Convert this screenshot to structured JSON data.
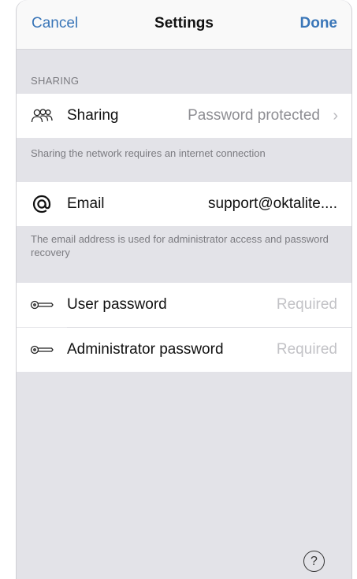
{
  "navbar": {
    "cancel_label": "Cancel",
    "title": "Settings",
    "done_label": "Done",
    "accent_color": "#3a76b8"
  },
  "sharing_section": {
    "header": "SHARING",
    "row": {
      "icon": "people-icon",
      "label": "Sharing",
      "value": "Password protected",
      "chevron": "›"
    },
    "footer": "Sharing the network requires an internet connection"
  },
  "email_section": {
    "row": {
      "icon": "at-sign-icon",
      "label": "Email",
      "value": "support@oktalite...."
    },
    "footer": "The email address is used for administrator access and password recovery"
  },
  "password_section": {
    "rows": [
      {
        "icon": "key-icon",
        "label": "User password",
        "placeholder": "Required"
      },
      {
        "icon": "key-icon",
        "label": "Administrator password",
        "placeholder": "Required"
      }
    ]
  },
  "help": {
    "icon": "help-icon",
    "glyph": "?"
  }
}
